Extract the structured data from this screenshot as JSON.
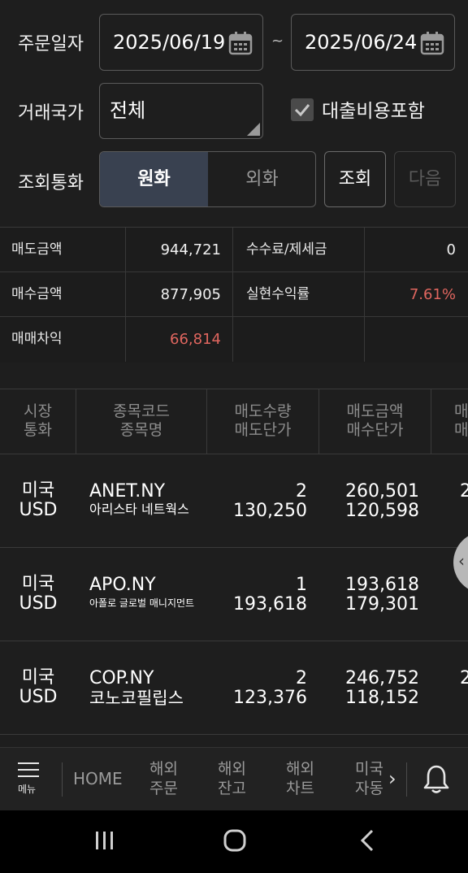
{
  "filters": {
    "order_date_label": "주문일자",
    "date_from": "2025/06/19",
    "date_to": "2025/06/24",
    "tilde": "~",
    "country_label": "거래국가",
    "country_value": "전체",
    "loan_include_label": "대출비용포함",
    "loan_include_checked": true,
    "currency_label": "조회통화",
    "currency_options": [
      "원화",
      "외화"
    ],
    "currency_selected": "원화",
    "search_button": "조회",
    "next_button": "다음"
  },
  "summary": {
    "rows": [
      {
        "label1": "매도금액",
        "value1": "944,721",
        "label2": "수수료/제세금",
        "value2": "0"
      },
      {
        "label1": "매수금액",
        "value1": "877,905",
        "label2": "실현수익률",
        "value2": "7.61%"
      },
      {
        "label1": "매매차익",
        "value1": "66,814",
        "label2": "",
        "value2": ""
      }
    ]
  },
  "table": {
    "headers": [
      {
        "line1": "시장",
        "line2": "통화"
      },
      {
        "line1": "종목코드",
        "line2": "종목명"
      },
      {
        "line1": "매도수량",
        "line2": "매도단가"
      },
      {
        "line1": "매도금액",
        "line2": "매수단가"
      },
      {
        "line1": "매",
        "line2": "매"
      }
    ],
    "rows": [
      {
        "market": "미국",
        "currency": "USD",
        "code": "ANET.NY",
        "name": "아리스타 네트웍스",
        "sell_qty": "2",
        "sell_price": "130,250",
        "sell_amount": "260,501",
        "buy_price": "120,598",
        "more": "2"
      },
      {
        "market": "미국",
        "currency": "USD",
        "code": "APO.NY",
        "name": "아폴로 글로벌 매니지먼트",
        "sell_qty": "1",
        "sell_price": "193,618",
        "sell_amount": "193,618",
        "buy_price": "179,301",
        "more": ""
      },
      {
        "market": "미국",
        "currency": "USD",
        "code": "COP.NY",
        "name": "코노코필립스",
        "sell_qty": "2",
        "sell_price": "123,376",
        "sell_amount": "246,752",
        "buy_price": "118,152",
        "more": "2"
      }
    ]
  },
  "bottom_nav": {
    "menu_label": "메뉴",
    "home": "HOME",
    "items": [
      {
        "line1": "해외",
        "line2": "주문"
      },
      {
        "line1": "해외",
        "line2": "잔고"
      },
      {
        "line1": "해외",
        "line2": "차트"
      },
      {
        "line1": "미국",
        "line2": "자동"
      }
    ]
  },
  "colors": {
    "background": "#1e1e1e",
    "accent_selected": "#394150",
    "negative_red": "#e0665f"
  },
  "icons": [
    "calendar-icon",
    "check-icon",
    "resize-corner-icon",
    "chevron-left-icon",
    "hamburger-menu-icon",
    "chevron-right-icon",
    "bell-icon",
    "recent-apps-icon",
    "home-circle-icon",
    "back-icon"
  ]
}
